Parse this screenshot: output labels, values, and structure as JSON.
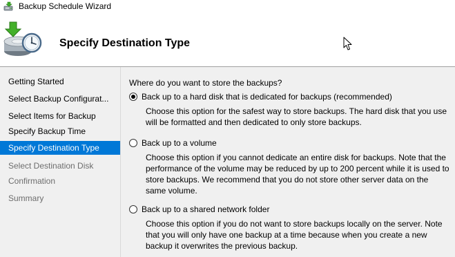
{
  "window": {
    "title": "Backup Schedule Wizard",
    "title_icon": "backup-wizard-icon"
  },
  "header": {
    "title": "Specify Destination Type",
    "icon": "backup-clock-icon"
  },
  "sidebar": {
    "items": [
      {
        "label": "Getting Started",
        "state": "done"
      },
      {
        "label": "Select Backup Configurat...",
        "state": "done"
      },
      {
        "label": "Select Items for Backup",
        "state": "done"
      },
      {
        "label": "Specify Backup Time",
        "state": "done"
      },
      {
        "label": "Specify Destination Type",
        "state": "active"
      },
      {
        "label": "Select Destination Disk",
        "state": "pending"
      },
      {
        "label": "Confirmation",
        "state": "pending"
      },
      {
        "label": "Summary",
        "state": "pending"
      }
    ]
  },
  "main": {
    "question": "Where do you want to store the backups?",
    "options": [
      {
        "label": "Back up to a hard disk that is dedicated for backups (recommended)",
        "description": "Choose this option for the safest way to store backups. The hard disk that you use will be formatted and then dedicated to only store backups.",
        "selected": true
      },
      {
        "label": "Back up to a volume",
        "description": "Choose this option if you cannot dedicate an entire disk for backups. Note that the performance of the volume may be reduced by up to 200 percent while it is used to store backups. We recommend that you do not store other server data on the same volume.",
        "selected": false
      },
      {
        "label": "Back up to a shared network folder",
        "description": "Choose this option if you do not want to store backups locally on the server. Note that you will only have one backup at a time because when you create a new backup it overwrites the previous backup.",
        "selected": false
      }
    ]
  },
  "colors": {
    "accent": "#0078d7",
    "panel_background": "#f0f0f0",
    "pending_text": "#6d6d6d"
  }
}
